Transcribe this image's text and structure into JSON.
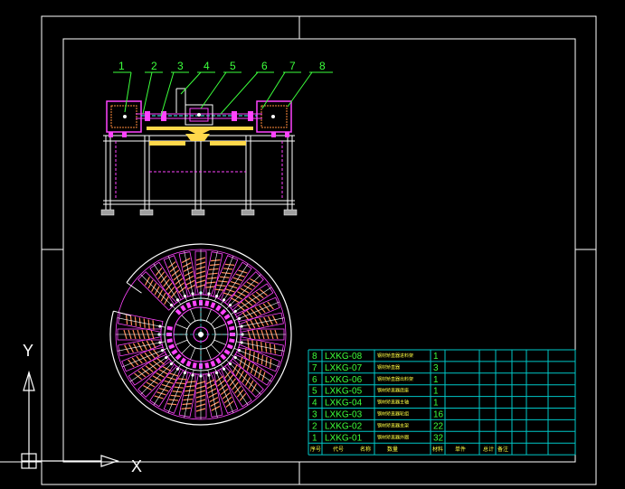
{
  "canvas": {
    "background": "#000000",
    "frame_color": "#ffffff",
    "table_color": "#00c8c8",
    "leader_color": "#3cff3c"
  },
  "callouts": [
    "1",
    "2",
    "3",
    "4",
    "5",
    "6",
    "7",
    "8"
  ],
  "parts_table": {
    "rows": [
      {
        "no": "8",
        "code": "LXKG-08",
        "name": "钢材矫直器进料架",
        "qty": "1"
      },
      {
        "no": "7",
        "code": "LXKG-07",
        "name": "钢材矫直器",
        "qty": "3"
      },
      {
        "no": "6",
        "code": "LXKG-06",
        "name": "钢材矫直器出料架",
        "qty": "1"
      },
      {
        "no": "5",
        "code": "LXKG-05",
        "name": "钢材矫直器底座",
        "qty": "1"
      },
      {
        "no": "4",
        "code": "LXKG-04",
        "name": "钢材矫直器主轴",
        "qty": "1"
      },
      {
        "no": "3",
        "code": "LXKG-03",
        "name": "钢材矫直器轮组",
        "qty": "16"
      },
      {
        "no": "2",
        "code": "LXKG-02",
        "name": "钢材矫直器支架",
        "qty": "22"
      },
      {
        "no": "1",
        "code": "LXKG-01",
        "name": "钢材矫直器外圈",
        "qty": "32"
      }
    ],
    "header": [
      "序号",
      "代号",
      "名称",
      "数量",
      "材料",
      "单件",
      "总计",
      "备注"
    ]
  },
  "ucs": {
    "y_label": "Y",
    "x_label": "X"
  }
}
